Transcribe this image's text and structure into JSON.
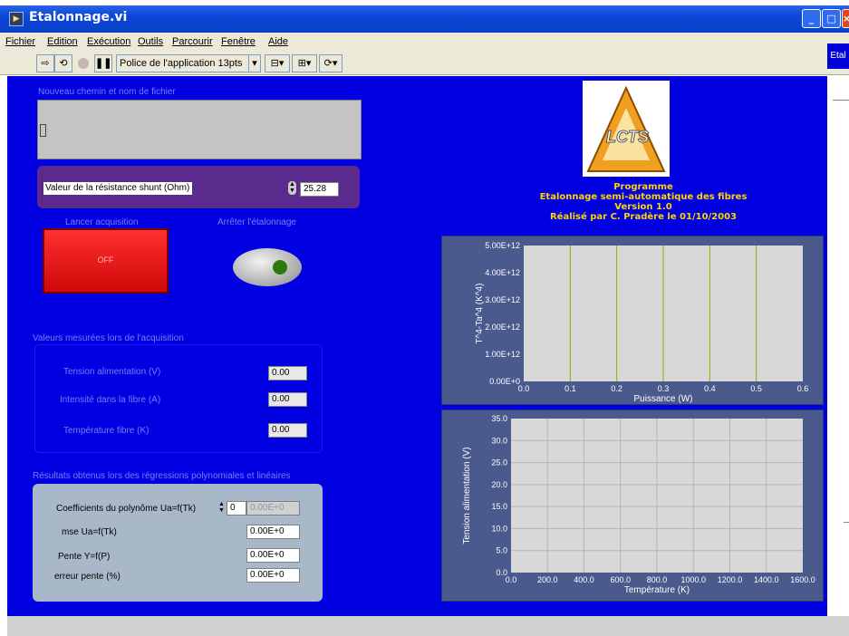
{
  "window": {
    "title": "Etalonnage.vi",
    "side_tab": "Etal",
    "min_icon": "minimize-icon",
    "max_icon": "maximize-icon",
    "close_icon": "close-icon"
  },
  "menu": [
    "Fichier",
    "Edition",
    "Exécution",
    "Outils",
    "Parcourir",
    "Fenêtre",
    "Aide"
  ],
  "toolbar": {
    "font_selector": "Police de l'application 13pts",
    "icons": [
      "run-arrow-icon",
      "run-continuous-icon",
      "abort-icon",
      "pause-icon",
      "align-icon",
      "distribute-icon",
      "reorder-icon"
    ]
  },
  "file": {
    "label": "Nouveau chemin et nom de fichier",
    "value": "",
    "icon": "path-icon"
  },
  "shunt": {
    "label": "Valeur de la résistance shunt (Ohm)",
    "value": "25.28"
  },
  "acquisition": {
    "label": "Lancer acquisition",
    "state": "OFF"
  },
  "stop": {
    "label": "Arrêter l'étalonnage"
  },
  "measured": {
    "title": "Valeurs mesurées lors de l'acquisition",
    "rows": [
      {
        "label": "Tension alimentation (V)",
        "value": "0.00"
      },
      {
        "label": "Intensité dans la fibre (A)",
        "value": "0.00"
      },
      {
        "label": "Température fibre (K)",
        "value": "0.00"
      }
    ]
  },
  "results": {
    "title": "Résultats obtenus lors des régressions polynomiales et linéaires",
    "coef_label": "Coefficients du polynôme Ua=f(Tk)",
    "coef_index": "0",
    "coef_value": "0.00E+0",
    "rows": [
      {
        "label": "mse Ua=f(Tk)",
        "value": "0.00E+0"
      },
      {
        "label": "Pente Y=f(P)",
        "value": "0.00E+0"
      },
      {
        "label": "erreur pente (%)",
        "value": "0.00E+0"
      }
    ]
  },
  "logo": {
    "text": "LCTS"
  },
  "program_info": [
    "Programme",
    "Etalonnage semi-automatique des fibres",
    "Version 1.0",
    "Réalisé par C. Pradère le 01/10/2003"
  ],
  "colors": {
    "panel_bg": "#0000e0",
    "button_off": "#e01010",
    "info_text": "#ffd400",
    "chart_plot_bg": "#d8d8d8",
    "chart1_grid": "#9aa800",
    "chart2_grid": "#b4b4b4"
  },
  "chart_data": [
    {
      "type": "line",
      "title": "",
      "xlabel": "Puissance (W)",
      "ylabel": "T^4-Ta^4 (K^4)",
      "xlim": [
        0,
        0.6
      ],
      "ylim": [
        0,
        5000000000000.0
      ],
      "x_ticks": [
        "0.0",
        "0.1",
        "0.2",
        "0.3",
        "0.4",
        "0.5",
        "0.6"
      ],
      "y_ticks": [
        "0.00E+0",
        "1.00E+12",
        "2.00E+12",
        "3.00E+12",
        "4.00E+12",
        "5.00E+12"
      ],
      "grid": "vertical",
      "series": []
    },
    {
      "type": "line",
      "title": "",
      "xlabel": "Température (K)",
      "ylabel": "Tension alimentation (V)",
      "xlim": [
        0,
        1600
      ],
      "ylim": [
        0,
        35
      ],
      "x_ticks": [
        "0.0",
        "200.0",
        "400.0",
        "600.0",
        "800.0",
        "1000.0",
        "1200.0",
        "1400.0",
        "1600.0"
      ],
      "y_ticks": [
        "0.0",
        "5.0",
        "10.0",
        "15.0",
        "20.0",
        "25.0",
        "30.0",
        "35.0"
      ],
      "grid": "both",
      "series": []
    }
  ]
}
